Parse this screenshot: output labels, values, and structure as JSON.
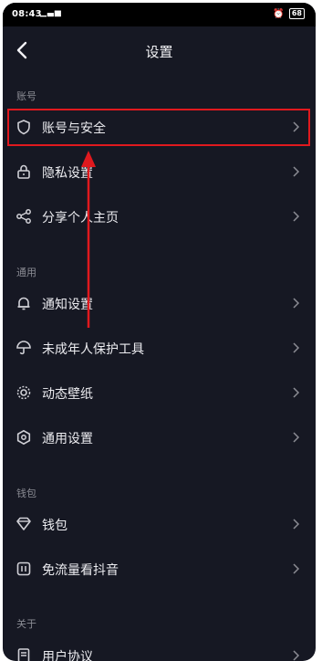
{
  "status_bar": {
    "time": "08:43",
    "signal": "ᵑᵑ",
    "battery": "68"
  },
  "header": {
    "title": "设置"
  },
  "sections": {
    "account": {
      "title": "账号",
      "items": [
        {
          "label": "账号与安全",
          "icon": "shield-icon"
        },
        {
          "label": "隐私设置",
          "icon": "lock-icon"
        },
        {
          "label": "分享个人主页",
          "icon": "share-icon"
        }
      ]
    },
    "general": {
      "title": "通用",
      "items": [
        {
          "label": "通知设置",
          "icon": "bell-icon"
        },
        {
          "label": "未成年人保护工具",
          "icon": "umbrella-icon"
        },
        {
          "label": "动态壁纸",
          "icon": "wallpaper-icon"
        },
        {
          "label": "通用设置",
          "icon": "hexagon-settings-icon"
        }
      ]
    },
    "wallet": {
      "title": "钱包",
      "items": [
        {
          "label": "钱包",
          "icon": "diamond-icon"
        },
        {
          "label": "免流量看抖音",
          "icon": "data-free-icon"
        }
      ]
    },
    "about": {
      "title": "关于",
      "items": [
        {
          "label": "用户协议",
          "icon": "document-icon"
        }
      ]
    }
  },
  "colors": {
    "background": "#161823",
    "highlight": "#e0191e"
  }
}
